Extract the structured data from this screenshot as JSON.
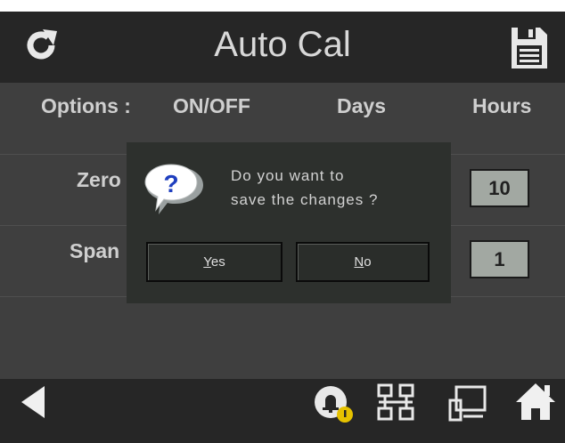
{
  "header": {
    "title": "Auto Cal",
    "refresh_icon": "refresh-icon",
    "save_icon": "floppy-disk-icon"
  },
  "table": {
    "columns": [
      "Options :",
      "ON/OFF",
      "Days",
      "Hours"
    ],
    "rows": [
      {
        "label": "Zero",
        "hours": "10"
      },
      {
        "label": "Span",
        "hours": "1"
      }
    ]
  },
  "dialog": {
    "icon": "question-balloon-icon",
    "message_line1": "Do you want to",
    "message_line2": "save the changes ?",
    "yes_label_accel": "Y",
    "yes_label_rest": "es",
    "no_label_accel": "N",
    "no_label_rest": "o"
  },
  "footer": {
    "icons": [
      "back-arrow-icon",
      "alarm-bell-icon",
      "network-icon",
      "device-icon",
      "home-icon"
    ],
    "alarm_badge_color": "#e6c200"
  },
  "colors": {
    "background": "#3f3f3f",
    "bar": "#262626",
    "value_box": "#a2a8a2",
    "text": "#cfcfcf"
  }
}
